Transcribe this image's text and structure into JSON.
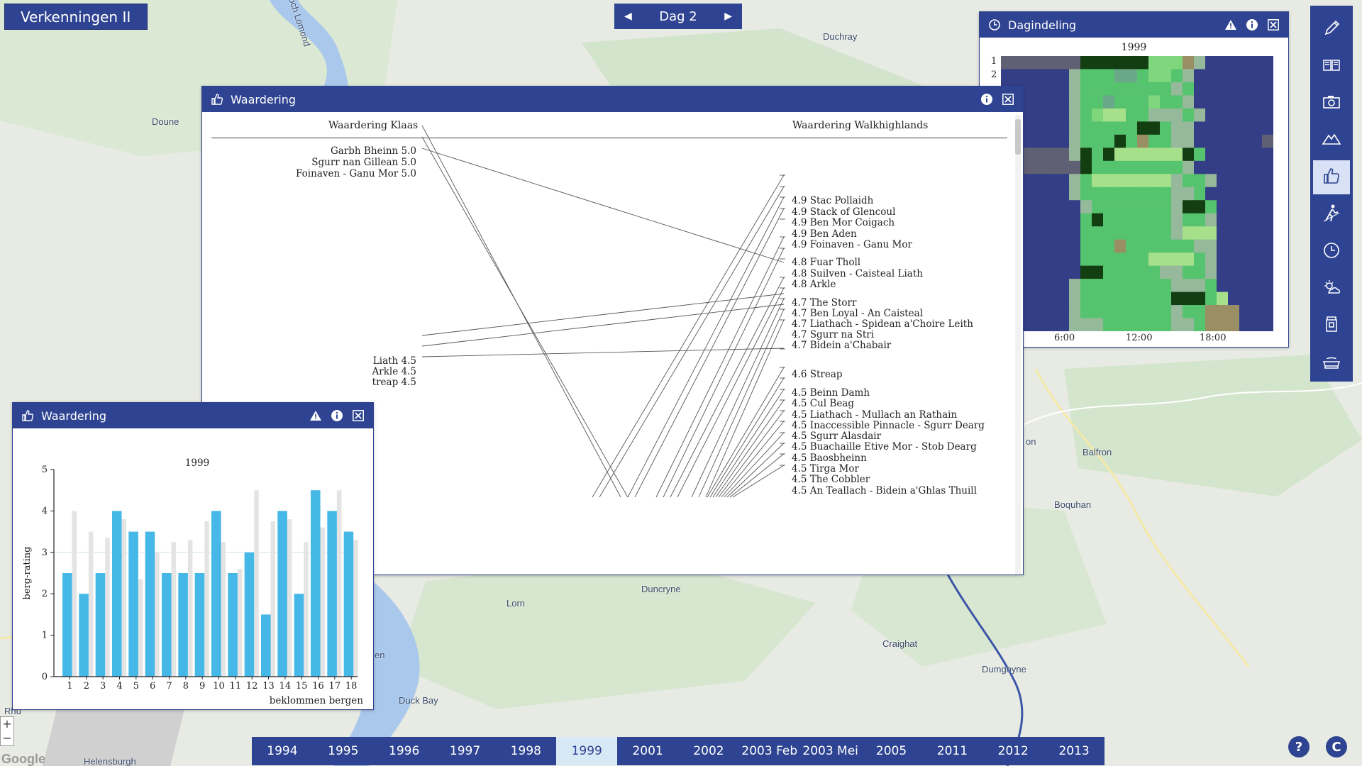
{
  "app": {
    "title": "Verkenningen II"
  },
  "day_nav": {
    "label": "Dag 2",
    "prev": "◀",
    "next": "▶"
  },
  "map_labels": [
    "Loch Lomond",
    "Duchray",
    "Doune",
    "Balfron",
    "Boquhan",
    "Lorn",
    "Duncryne",
    "Craighat",
    "Dumgoyne",
    "Duck Bay",
    "Helensburgh",
    "Rhu",
    "on",
    "en"
  ],
  "map_attribution": "Google",
  "zoom": {
    "in": "+",
    "out": "−"
  },
  "dagindeling": {
    "title": "Dagindeling",
    "year": "1999",
    "row_labels": [
      "1",
      "2"
    ],
    "x_ticks": [
      "6:00",
      "12:00",
      "18:00"
    ]
  },
  "waardering_main": {
    "title": "Waardering",
    "left_header": "Waardering Klaas",
    "right_header": "Waardering Walkhighlands",
    "left_items": [
      "Garbh Bheinn 5.0",
      "Sgurr nan Gillean 5.0",
      "Foinaven - Ganu Mor 5.0",
      "Liath 4.5",
      "Arkle 4.5",
      "treap 4.5"
    ],
    "right_items": [
      "4.9 Stac Pollaidh",
      "4.9 Stack of Glencoul",
      "4.9 Ben Mor Coigach",
      "4.9 Ben Aden",
      "4.9 Foinaven - Ganu Mor",
      "4.8 Fuar Tholl",
      "4.8 Suilven - Caisteal Liath",
      "4.8 Arkle",
      "4.7 The Storr",
      "4.7 Ben Loyal - An Caisteal",
      "4.7 Liathach - Spidean a'Choire Leith",
      "4.7 Sgurr na Stri",
      "4.7 Bidein a'Chabair",
      "4.6 Streap",
      "4.5 Beinn Damh",
      "4.5 Cul Beag",
      "4.5 Liathach - Mullach an Rathain",
      "4.5 Inaccessible Pinnacle - Sgurr Dearg",
      "4.5 Sgurr Alasdair",
      "4.5 Buachaille Etive Mor - Stob Dearg",
      "4.5 Baosbheinn",
      "4.5 Tirga Mor",
      "4.5 The Cobbler",
      "4.5 An Teallach - Bidein a'Ghlas Thuill"
    ]
  },
  "waardering_chart": {
    "title": "Waardering",
    "chart_title": "1999",
    "ylabel": "berg-rating",
    "xlabel": "beklommen bergen"
  },
  "chart_data": {
    "type": "bar",
    "title": "1999",
    "xlabel": "beklommen bergen",
    "ylabel": "berg-rating",
    "categories": [
      "1",
      "2",
      "3",
      "4",
      "5",
      "6",
      "7",
      "8",
      "9",
      "10",
      "11",
      "12",
      "13",
      "14",
      "15",
      "16",
      "17",
      "18"
    ],
    "ylim": [
      0,
      5
    ],
    "yticks": [
      0,
      1,
      2,
      3,
      4,
      5
    ],
    "series": [
      {
        "values": [
          2.5,
          2.0,
          2.5,
          4.0,
          3.5,
          3.5,
          2.5,
          2.5,
          2.5,
          4.0,
          2.5,
          3.0,
          1.5,
          4.0,
          2.0,
          4.5,
          4.0,
          3.5
        ],
        "color": "#45b8e8"
      },
      {
        "values": [
          4.0,
          3.5,
          3.35,
          3.8,
          2.35,
          3.0,
          3.25,
          3.3,
          3.75,
          3.25,
          2.6,
          4.5,
          3.75,
          3.8,
          3.25,
          3.6,
          4.5,
          3.3
        ],
        "color": "#e4e4e4"
      }
    ],
    "reference_line": 3.0
  },
  "sidebar": {
    "items": [
      "pencil-icon",
      "book-icon",
      "camera-icon",
      "mountain-icon",
      "thumbs-up-icon",
      "hiker-icon",
      "clock-icon",
      "weather-icon",
      "jar-icon",
      "food-icon"
    ],
    "active_index": 4
  },
  "years": [
    "1994",
    "1995",
    "1996",
    "1997",
    "1998",
    "1999",
    "2001",
    "2002",
    "2003 Feb",
    "2003 Mei",
    "2005",
    "2011",
    "2012",
    "2013"
  ],
  "active_year": "1999",
  "help": "?",
  "refresh": "C"
}
